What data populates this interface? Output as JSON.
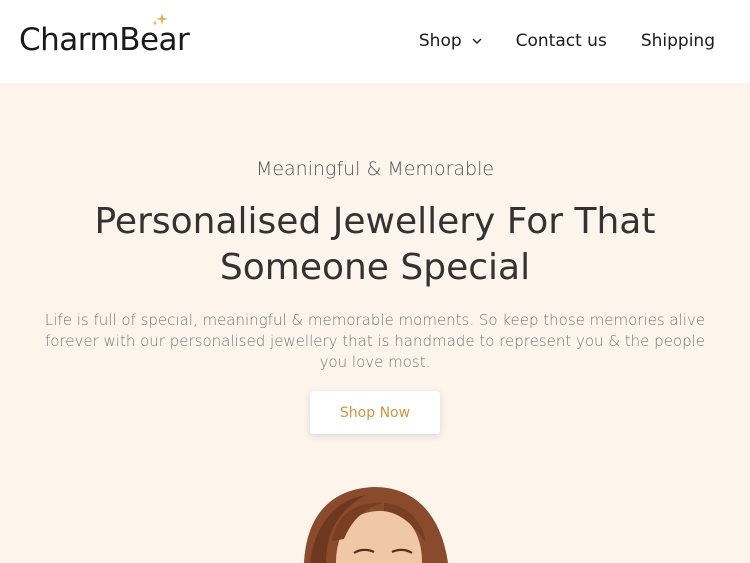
{
  "header": {
    "logo_text": "CharmBear",
    "nav": {
      "shop": "Shop",
      "contact": "Contact us",
      "shipping": "Shipping"
    }
  },
  "hero": {
    "eyebrow": "Meaningful & Memorable",
    "headline": "Personalised Jewellery For That Someone Special",
    "lede": "Life is full of special, meaningful & memorable moments. So keep those memories alive forever with our personalised jewellery that is handmade to represent you & the people you love most.",
    "cta_label": "Shop Now"
  },
  "colors": {
    "hero_background": "#fdf5ec",
    "accent": "#d4943c",
    "sparkle": "#e8b04a",
    "text_dark": "#333333"
  },
  "icons": {
    "shop_dropdown": "chevron-down-icon",
    "logo_decoration": "sparkle-icon"
  }
}
